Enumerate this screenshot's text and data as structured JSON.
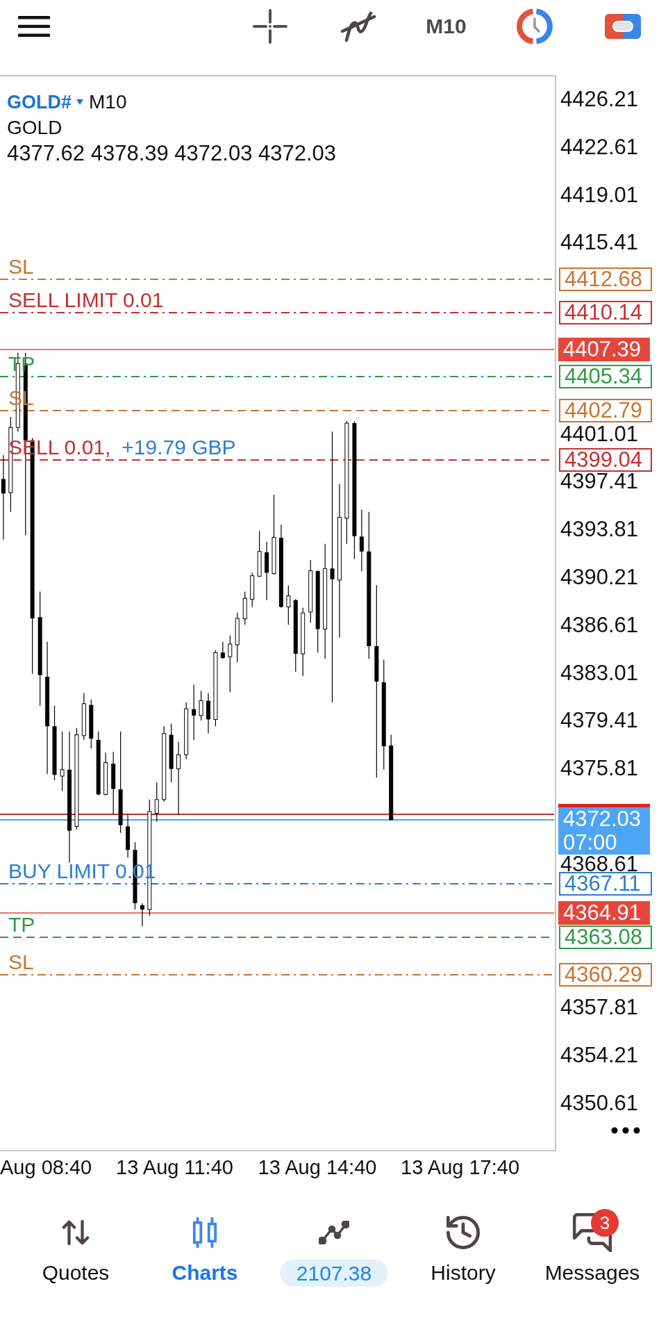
{
  "top_bar": {
    "timeframe": "M10"
  },
  "chart": {
    "symbol": "GOLD#",
    "timeframe": "M10",
    "name": "GOLD",
    "ohlc": "4377.62 4378.39 4372.03 4372.03",
    "price_axis": [
      "4426.21",
      "4422.61",
      "4419.01",
      "4415.41",
      "4401.01",
      "4397.41",
      "4393.81",
      "4390.21",
      "4386.61",
      "4383.01",
      "4379.41",
      "4375.81",
      "4368.61",
      "4357.81",
      "4354.21",
      "4350.61"
    ],
    "levels": [
      {
        "kind": "pending",
        "label": "SL",
        "price": "4412.68",
        "color": "#c97430"
      },
      {
        "kind": "pending",
        "label": "SELL LIMIT 0.01",
        "price": "4410.14",
        "color": "#c62f2f"
      },
      {
        "kind": "price",
        "price": "4407.39",
        "color": "#e5463b"
      },
      {
        "kind": "pending",
        "label": "TP",
        "price": "4405.34",
        "color": "#2f9a46"
      },
      {
        "kind": "position",
        "label": "SL",
        "price": "4402.79",
        "color": "#c97430"
      },
      {
        "kind": "position",
        "label": "SELL 0.01,",
        "profit": "+19.79 GBP",
        "price": "4399.04",
        "color": "#c62f2f"
      },
      {
        "kind": "pending",
        "label": "BUY LIMIT 0.01",
        "price": "4367.11",
        "color": "#2d7dd2"
      },
      {
        "kind": "price",
        "price": "4364.91",
        "color": "#e5463b"
      },
      {
        "kind": "position",
        "label": "TP",
        "price": "4363.08",
        "color": "#2f9a46"
      },
      {
        "kind": "pending",
        "label": "SL",
        "price": "4360.29",
        "color": "#c97430"
      }
    ],
    "bid": {
      "price": "4372.03",
      "time": "07:00"
    },
    "time_axis": [
      "Aug 08:40",
      "13 Aug 11:40",
      "13 Aug 14:40",
      "13 Aug 17:40"
    ]
  },
  "nav": [
    {
      "label": "Quotes",
      "kind": "tab",
      "selected": false
    },
    {
      "label": "Charts",
      "kind": "tab",
      "selected": true
    },
    {
      "label": "2107.38",
      "kind": "balance",
      "selected": false
    },
    {
      "label": "History",
      "kind": "tab",
      "selected": false
    },
    {
      "label": "Messages",
      "kind": "tab",
      "selected": false,
      "badge": "3"
    }
  ]
}
